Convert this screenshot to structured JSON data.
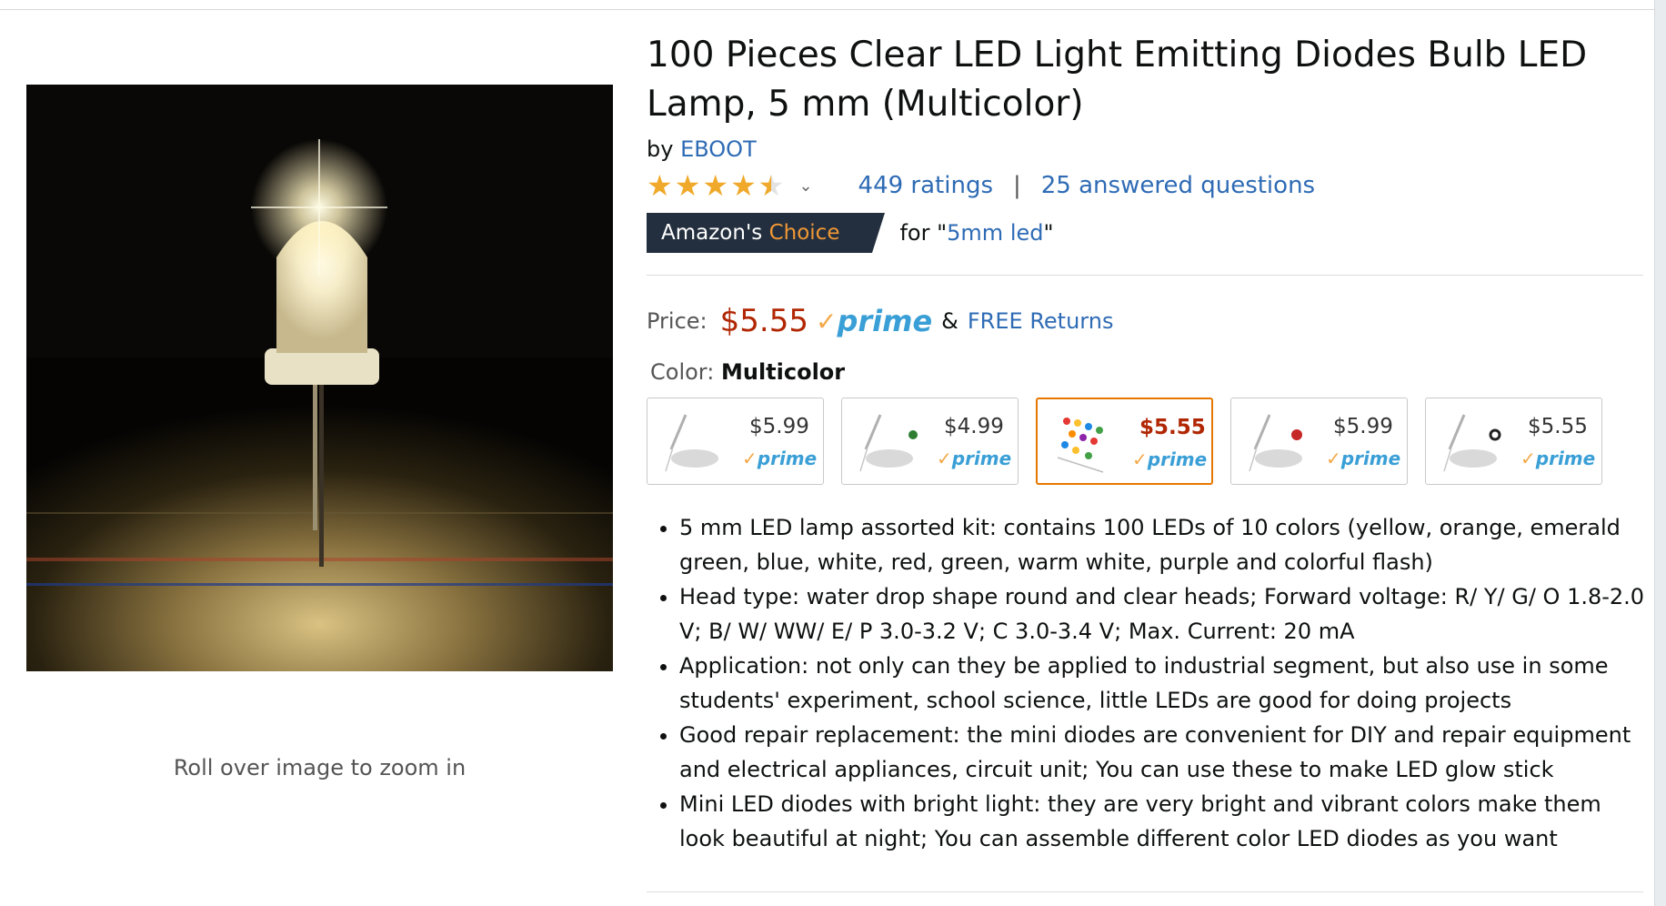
{
  "product": {
    "title": "100 Pieces Clear LED Light Emitting Diodes Bulb LED Lamp, 5 mm (Multicolor)",
    "by_label": "by",
    "brand": "EBOOT",
    "rating": 4.5,
    "ratings_text": "449 ratings",
    "separator": "|",
    "questions_text": "25 answered questions",
    "choice": {
      "prefix": "Amazon's",
      "accent": "Choice",
      "for_text": "for \"",
      "query": "5mm led",
      "close_quote": "\""
    },
    "price_label": "Price:",
    "price": "$5.55",
    "prime": "prime",
    "amp": "&",
    "returns": "FREE Returns",
    "color_label": "Color:",
    "color_value": "Multicolor",
    "zoom_hint": "Roll over image to zoom in"
  },
  "swatches": [
    {
      "price": "$5.99",
      "prime": "prime",
      "dot": "none"
    },
    {
      "price": "$4.99",
      "prime": "prime",
      "dot": "#2e7d32"
    },
    {
      "price": "$5.55",
      "prime": "prime",
      "dot": "multi",
      "selected": true
    },
    {
      "price": "$5.99",
      "prime": "prime",
      "dot": "#c62828"
    },
    {
      "price": "$5.55",
      "prime": "prime",
      "dot": "#222222"
    }
  ],
  "bullets": [
    "5 mm LED lamp assorted kit: contains 100 LEDs of 10 colors (yellow, orange, emerald green, blue, white, red, green, warm white, purple and colorful flash)",
    "Head type: water drop shape round and clear heads; Forward voltage: R/ Y/ G/ O 1.8-2.0 V; B/ W/ WW/ E/ P 3.0-3.2 V; C 3.0-3.4 V; Max. Current: 20 mA",
    "Application: not only can they be applied to industrial segment, but also use in some students' experiment, school science, little LEDs are good for doing projects",
    "Good repair replacement: the mini diodes are convenient for DIY and repair equipment and electrical appliances, circuit unit; You can use these to make LED glow stick",
    "Mini LED diodes with bright light: they are very bright and vibrant colors make them look beautiful at night; You can assemble different color LED diodes as you want"
  ],
  "colors": {
    "link": "#2e6bb5",
    "price": "#b12704",
    "prime": "#3a9fd6",
    "check": "#f3a847",
    "star": "#f0a92a",
    "badge_bg": "#232f3e",
    "badge_accent": "#f09835",
    "selected_border": "#e77600"
  }
}
